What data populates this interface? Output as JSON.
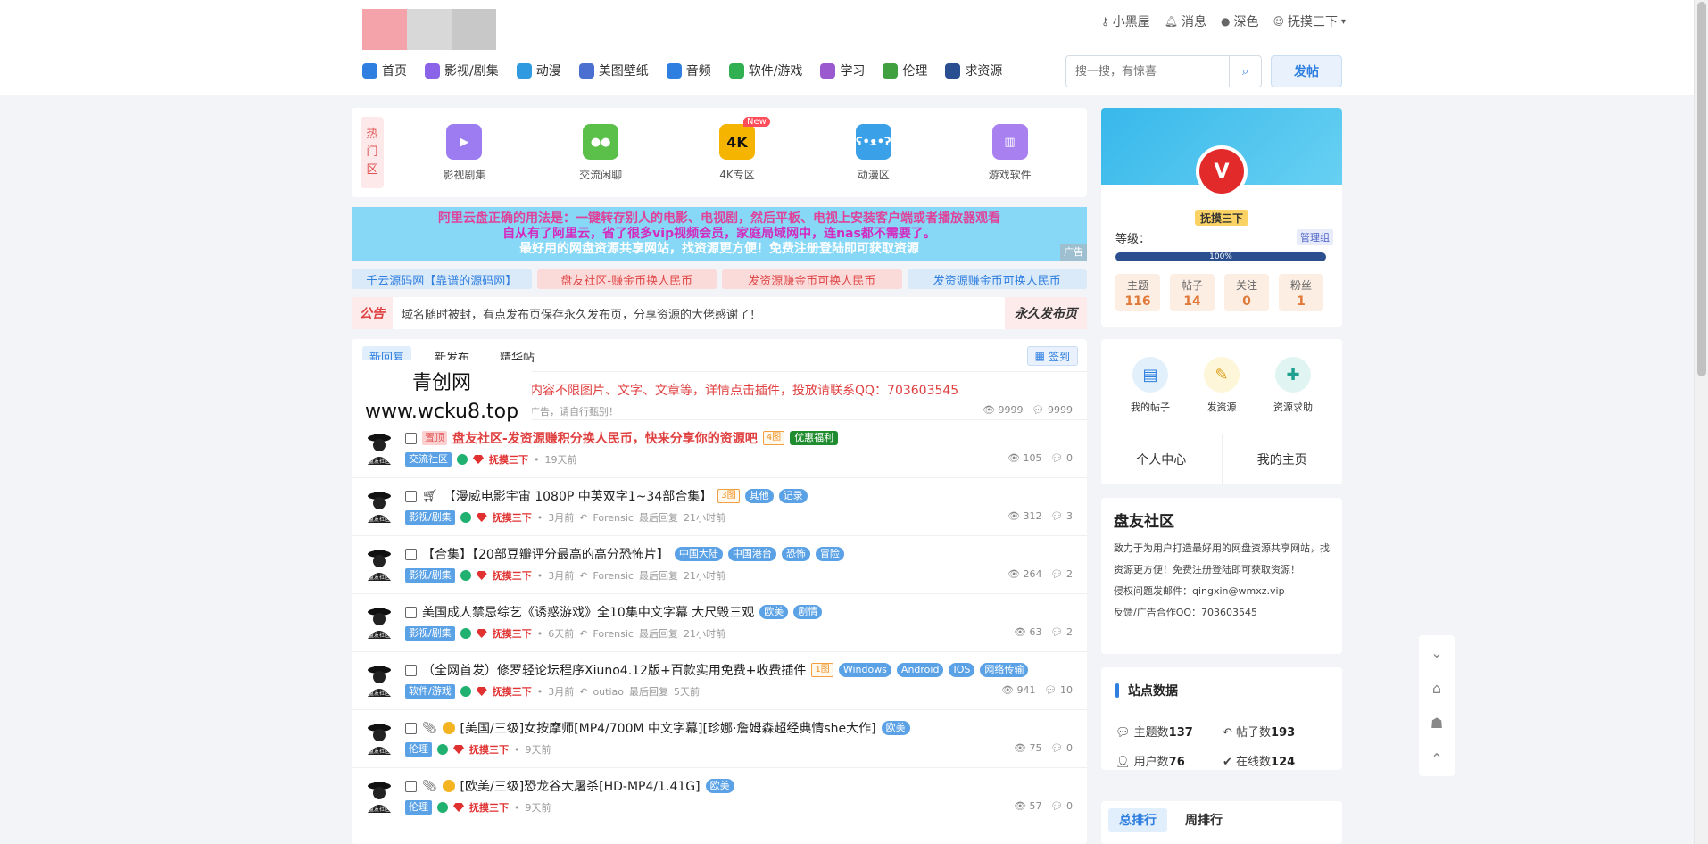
{
  "topbar": {
    "logo_colors": [
      "#f4a3ab",
      "#d8d8d8",
      "#c8c8c8"
    ],
    "links": [
      {
        "icon": "key-icon",
        "label": "小黑屋"
      },
      {
        "icon": "bell-icon",
        "label": "消息"
      },
      {
        "icon": "dark-mode-icon",
        "label": "深色"
      },
      {
        "icon": "user-avatar-icon",
        "label": "抚摸三下"
      }
    ],
    "nav": [
      {
        "icon": "home-icon",
        "label": "首页",
        "color": "#2f7fe0"
      },
      {
        "icon": "video-icon",
        "label": "影视/剧集",
        "color": "#8a63e8"
      },
      {
        "icon": "bear-icon",
        "label": "动漫",
        "color": "#2f9ae0"
      },
      {
        "icon": "picture-icon",
        "label": "美图壁纸",
        "color": "#4a6fd0"
      },
      {
        "icon": "headphone-icon",
        "label": "音频",
        "color": "#2f7fe0"
      },
      {
        "icon": "apps-icon",
        "label": "软件/游戏",
        "color": "#30b050"
      },
      {
        "icon": "book-icon",
        "label": "学习",
        "color": "#9b59d0"
      },
      {
        "icon": "leaf-icon",
        "label": "伦理",
        "color": "#40a040"
      },
      {
        "icon": "ticket-icon",
        "label": "求资源",
        "color": "#2a4f90"
      }
    ],
    "search_placeholder": "搜一搜，有惊喜",
    "post_button": "发帖"
  },
  "hot": {
    "label": "热门区",
    "items": [
      {
        "label": "影视剧集",
        "icon": "video-icon",
        "color": "#9c7cf0",
        "glyph": "▶"
      },
      {
        "label": "交流闲聊",
        "icon": "wechat-icon",
        "color": "#5ac04a",
        "glyph": "●●"
      },
      {
        "label": "4K专区",
        "icon": "4k-icon",
        "color": "#f5b400",
        "glyph": "4K",
        "badge": "New"
      },
      {
        "label": "动漫区",
        "icon": "bear-icon",
        "color": "#3aa0e8",
        "glyph": "ʕ•ᴥ•ʔ"
      },
      {
        "label": "游戏软件",
        "icon": "game-book-icon",
        "color": "#a880f0",
        "glyph": "▥"
      }
    ]
  },
  "ad": {
    "line1": "阿里云盘正确的用法是：一键转存别人的电影、电视剧，然后平板、电视上安装客户端或者播放器观看",
    "line2": "自从有了阿里云，省了很多vip视频会员，家庭局域网中，连nas都不需要了。",
    "line3": "最好用的网盘资源共享网站，找资源更方便！免费注册登陆即可获取资源",
    "tag": "广告"
  },
  "links": [
    {
      "label": "千云源码网【靠谱的源码网】",
      "bg": "#dbeaf8",
      "color": "#2f7fe0"
    },
    {
      "label": "盘友社区-赚金币换人民币",
      "bg": "#fbdada",
      "color": "#e04a4a"
    },
    {
      "label": "发资源赚金币可换人民币",
      "bg": "#fbdada",
      "color": "#e04a4a"
    },
    {
      "label": "发资源赚金币可换人民币",
      "bg": "#dbeaf8",
      "color": "#2f7fe0"
    }
  ],
  "notice": {
    "label": "公告",
    "text": "域名随时被封，有点发布页保存永久发布页，分享资源的大佬感谢了！",
    "right": "永久发布页"
  },
  "list": {
    "tabs": [
      "新回复",
      "新发布",
      "精华帖"
    ],
    "sign_button": "签到",
    "watermark": {
      "line1": "青创网",
      "line2": "www.wcku8.top"
    },
    "ad_row": {
      "title": "内容不限图片、文字、文章等，详情点击插件，投放请联系QQ：703603545",
      "sub": "广告，请自行甄别！",
      "views": "9999",
      "replies": "9999"
    },
    "rows": [
      {
        "top_tag": "置顶",
        "title": "盘友社区-发资源赚积分换人民币，快来分享你的资源吧",
        "title_color": "#e04040",
        "bold": true,
        "img_tag": "4图",
        "tags": [],
        "green_tag": "优惠福利",
        "category": "交流社区",
        "user": "抚摸三下",
        "time": "19天前",
        "last_user": "",
        "last_label": "",
        "last_time": "",
        "views": "105",
        "replies": "0",
        "prefix": "",
        "coin": false
      },
      {
        "top_tag": "",
        "title": "【漫威电影宇宙 1080P 中英双字1~34部合集】",
        "title_color": "#222",
        "bold": false,
        "img_tag": "3图",
        "tags": [
          "其他",
          "记录"
        ],
        "green_tag": "",
        "category": "影视/剧集",
        "user": "抚摸三下",
        "time": "3月前",
        "last_user": "Forensic",
        "last_label": "最后回复",
        "last_time": "21小时前",
        "views": "312",
        "replies": "3",
        "prefix": "cart",
        "coin": false
      },
      {
        "top_tag": "",
        "title": "【合集】【20部豆瓣评分最高的高分恐怖片】",
        "title_color": "#222",
        "bold": false,
        "img_tag": "",
        "tags": [
          "中国大陆",
          "中国港台",
          "恐怖",
          "冒险"
        ],
        "green_tag": "",
        "category": "影视/剧集",
        "user": "抚摸三下",
        "time": "3月前",
        "last_user": "Forensic",
        "last_label": "最后回复",
        "last_time": "21小时前",
        "views": "264",
        "replies": "2",
        "prefix": "",
        "coin": false
      },
      {
        "top_tag": "",
        "title": "美国成人禁忌综艺《诱惑游戏》全10集中文字幕 大尺毁三观",
        "title_color": "#222",
        "bold": false,
        "img_tag": "",
        "tags": [
          "欧美",
          "剧情"
        ],
        "green_tag": "",
        "category": "影视/剧集",
        "user": "抚摸三下",
        "time": "6天前",
        "last_user": "Forensic",
        "last_label": "最后回复",
        "last_time": "21小时前",
        "views": "63",
        "replies": "2",
        "prefix": "",
        "coin": false
      },
      {
        "top_tag": "",
        "title": "（全网首发）修罗轻论坛程序Xiuno4.12版+百款实用免费+收费插件",
        "title_color": "#222",
        "bold": false,
        "img_tag": "1图",
        "tags": [
          "Windows",
          "Android",
          "IOS",
          "网络传输"
        ],
        "green_tag": "",
        "category": "软件/游戏",
        "user": "抚摸三下",
        "time": "3月前",
        "last_user": "outiao",
        "last_label": "最后回复",
        "last_time": "5天前",
        "views": "941",
        "replies": "10",
        "prefix": "",
        "coin": false
      },
      {
        "top_tag": "",
        "title": "[美国/三级]女按摩师[MP4/700M 中文字幕][珍娜·詹姆森超经典情she大作]",
        "title_color": "#222",
        "bold": false,
        "img_tag": "",
        "tags": [
          "欧美"
        ],
        "green_tag": "",
        "category": "伦理",
        "user": "抚摸三下",
        "time": "9天前",
        "last_user": "",
        "last_label": "",
        "last_time": "",
        "views": "75",
        "replies": "0",
        "prefix": "clip",
        "coin": true
      },
      {
        "top_tag": "",
        "title": "[欧美/三级]恐龙谷大屠杀[HD-MP4/1.41G]",
        "title_color": "#222",
        "bold": false,
        "img_tag": "",
        "tags": [
          "欧美"
        ],
        "green_tag": "",
        "category": "伦理",
        "user": "抚摸三下",
        "time": "9天前",
        "last_user": "",
        "last_label": "",
        "last_time": "",
        "views": "57",
        "replies": "0",
        "prefix": "clip",
        "coin": true
      }
    ]
  },
  "profile": {
    "name": "抚摸三下",
    "avatar_glyph": "V",
    "level_label": "等级：",
    "group": "管理组",
    "progress_label": "100%",
    "progress": 1.0,
    "stats": [
      {
        "k": "主题",
        "v": "116"
      },
      {
        "k": "帖子",
        "v": "14"
      },
      {
        "k": "关注",
        "v": "0"
      },
      {
        "k": "粉丝",
        "v": "1"
      }
    ]
  },
  "quick": {
    "items": [
      {
        "label": "我的帖子",
        "icon": "doc-icon",
        "bg": "#e2f0fb",
        "color": "#2f7fe0",
        "glyph": "▤"
      },
      {
        "label": "发资源",
        "icon": "edit-icon",
        "bg": "#fdf6d8",
        "color": "#e0a020",
        "glyph": "✎"
      },
      {
        "label": "资源求助",
        "icon": "help-icon",
        "bg": "#e0f5f1",
        "color": "#20a090",
        "glyph": "✚"
      }
    ],
    "center": "个人中心",
    "home": "我的主页"
  },
  "about": {
    "title": "盘友社区",
    "desc": "致力于为用户打造最好用的网盘资源共享网站，找资源更方便！免费注册登陆即可获取资源！",
    "contact1": "侵权问题发邮件：qingxin@wmxz.vip",
    "contact2": "反馈/广告合作QQ：703603545"
  },
  "site": {
    "title": "站点数据",
    "stats": [
      {
        "icon": "comment-icon",
        "k": "主题数",
        "v": "137"
      },
      {
        "icon": "reply-icon",
        "k": "帖子数",
        "v": "193"
      },
      {
        "icon": "user-icon",
        "k": "用户数",
        "v": "76"
      },
      {
        "icon": "check-icon",
        "k": "在线数",
        "v": "124"
      }
    ]
  },
  "rank": {
    "tabs": [
      "总排行",
      "周排行"
    ]
  }
}
